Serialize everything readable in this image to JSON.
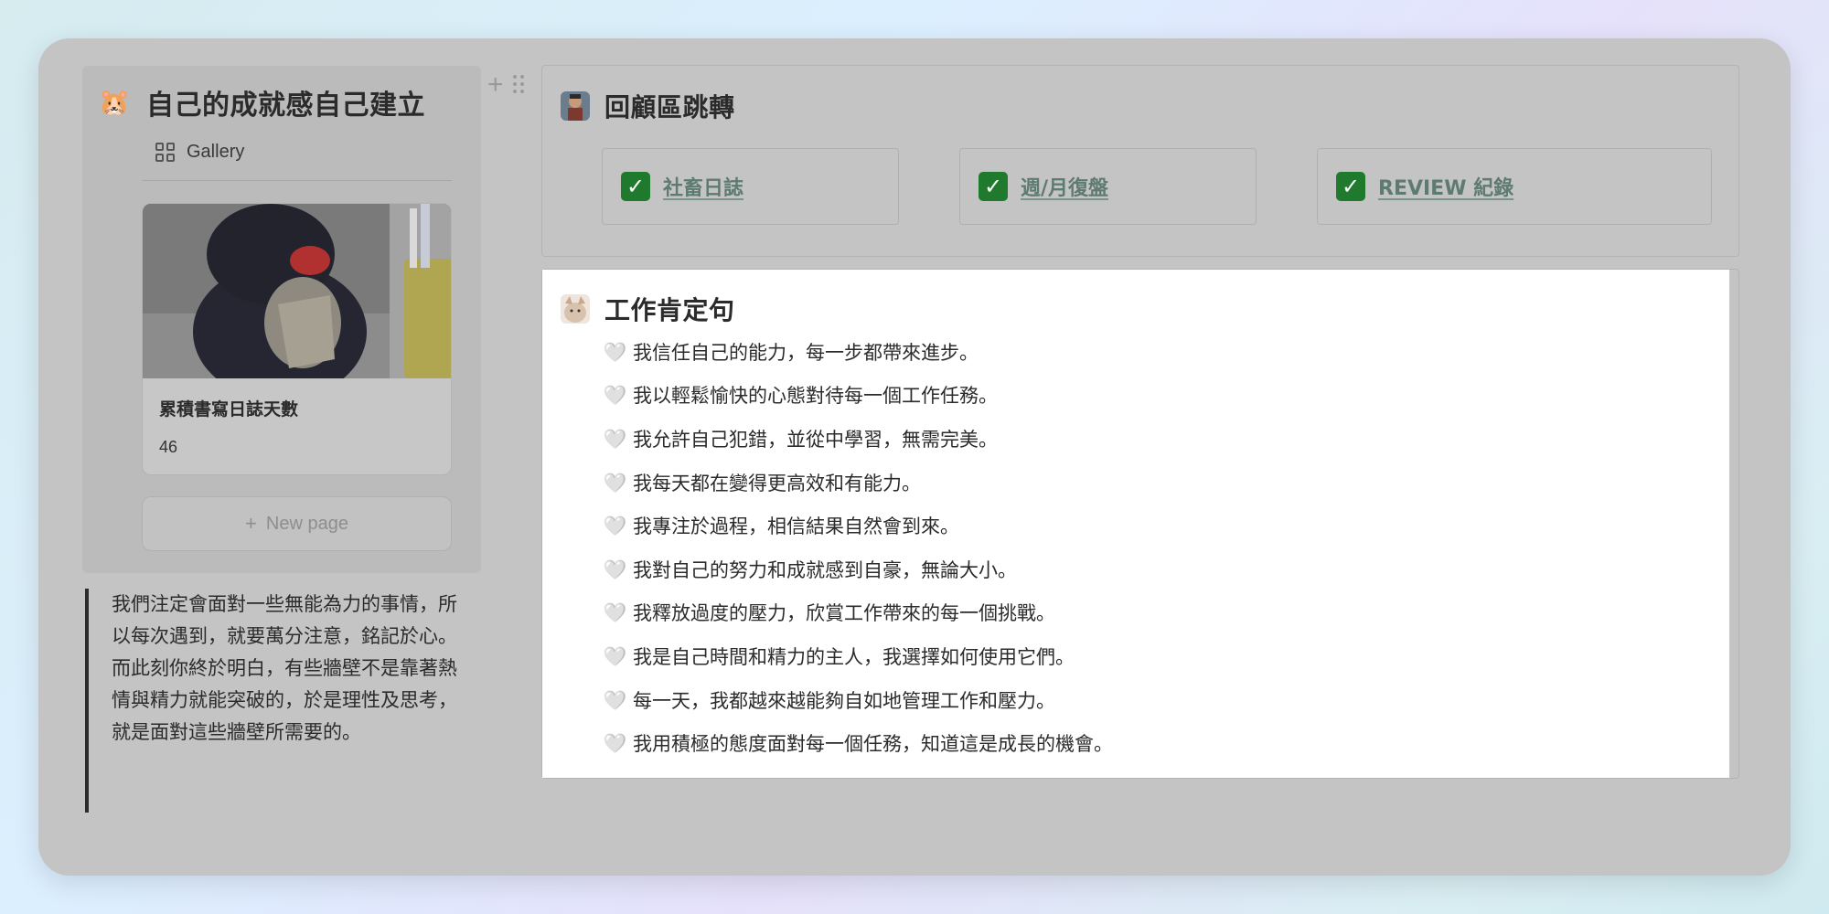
{
  "left": {
    "title_emoji": "🐹",
    "title": "自己的成就感自己建立",
    "view_tab": {
      "icon": "gallery-grid-icon",
      "label": "Gallery"
    },
    "card": {
      "title": "累積書寫日誌天數",
      "value": "46"
    },
    "new_page": {
      "icon": "plus-icon",
      "label": "New page"
    },
    "quote_lines": [
      "我們注定會面對一些無能為力的事情，所以每次遇到，就要萬分注意，銘記於心。",
      "而此刻你終於明白，有些牆壁不是靠著熱情與精力就能突破的，於是理性及思考，就是面對這些牆壁所需要的。"
    ]
  },
  "review": {
    "title": "回顧區跳轉",
    "links": [
      {
        "icon": "check-icon",
        "label": "社畜日誌"
      },
      {
        "icon": "check-icon",
        "label": "週/月復盤"
      },
      {
        "icon": "check-icon",
        "label": "REVIEW 紀錄"
      }
    ]
  },
  "affirmations": {
    "title": "工作肯定句",
    "bullet_icon": "🤍",
    "items": [
      "我信任自己的能力，每一步都帶來進步。",
      "我以輕鬆愉快的心態對待每一個工作任務。",
      "我允許自己犯錯，並從中學習，無需完美。",
      "我每天都在變得更高效和有能力。",
      "我專注於過程，相信結果自然會到來。",
      "我對自己的努力和成就感到自豪，無論大小。",
      "我釋放過度的壓力，欣賞工作帶來的每一個挑戰。",
      "我是自己時間和精力的主人，我選擇如何使用它們。",
      "每一天，我都越來越能夠自如地管理工作和壓力。",
      "我用積極的態度面對每一個任務，知道這是成長的機會。"
    ]
  }
}
